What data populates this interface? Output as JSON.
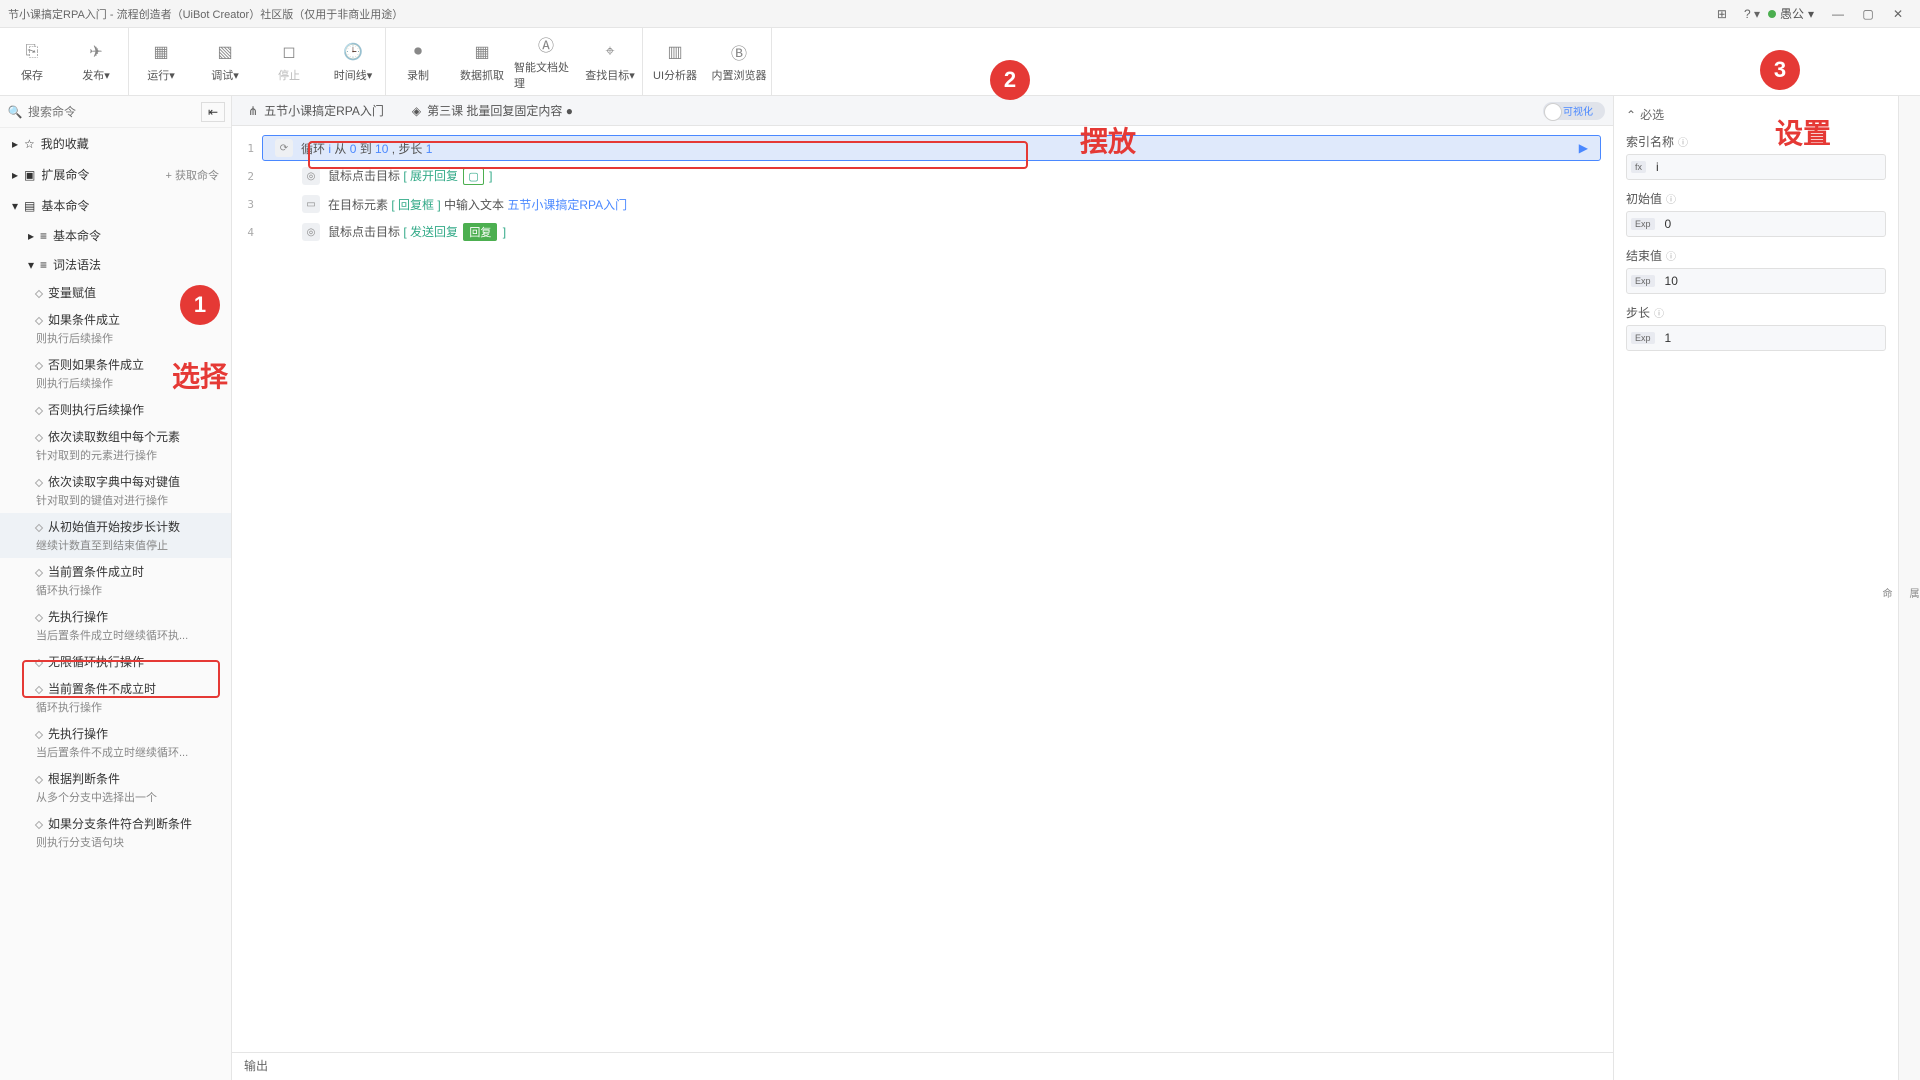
{
  "titlebar": {
    "title": "节小课搞定RPA入门 - 流程创造者（UiBot Creator）社区版（仅用于非商业用途）",
    "user": "愚公",
    "grid_icon": "⊞"
  },
  "toolbar": {
    "groups": [
      [
        {
          "label": "保存",
          "icon": "💾"
        },
        {
          "label": "发布▾",
          "icon": "✈"
        }
      ],
      [
        {
          "label": "运行▾",
          "icon": "▷"
        },
        {
          "label": "调试▾",
          "icon": "🐞"
        },
        {
          "label": "停止",
          "icon": "◻",
          "disabled": true
        },
        {
          "label": "时间线▾",
          "icon": "🕒"
        }
      ],
      [
        {
          "label": "录制",
          "icon": "⏺"
        },
        {
          "label": "数据抓取",
          "icon": "▦"
        },
        {
          "label": "智能文档处理",
          "icon": "Ⓐ"
        },
        {
          "label": "查找目标▾",
          "icon": "🔍"
        }
      ],
      [
        {
          "label": "UI分析器",
          "icon": "▥"
        },
        {
          "label": "内置浏览器",
          "icon": "Ⓑ"
        }
      ]
    ]
  },
  "sidebar": {
    "search_placeholder": "搜索命令",
    "acquire": "获取命令",
    "cats": [
      {
        "icon": "☆",
        "label": "我的收藏"
      },
      {
        "icon": "▣",
        "label": "扩展命令",
        "extra": true
      },
      {
        "icon": "▤",
        "label": "基本命令"
      }
    ],
    "subcats": [
      {
        "label": "基本命令",
        "expand": true
      },
      {
        "label": "词法语法",
        "expand": true
      }
    ],
    "cmds": [
      {
        "title": "变量赋值",
        "desc": ""
      },
      {
        "title": "如果条件成立",
        "desc": "则执行后续操作"
      },
      {
        "title": "否则如果条件成立",
        "desc": "则执行后续操作"
      },
      {
        "title": "否则执行后续操作",
        "desc": ""
      },
      {
        "title": "依次读取数组中每个元素",
        "desc": "针对取到的元素进行操作"
      },
      {
        "title": "依次读取字典中每对键值",
        "desc": "针对取到的键值对进行操作"
      },
      {
        "title": "从初始值开始按步长计数",
        "desc": "继续计数直至到结束值停止",
        "hl": true
      },
      {
        "title": "当前置条件成立时",
        "desc": "循环执行操作"
      },
      {
        "title": "先执行操作",
        "desc": "当后置条件成立时继续循环执..."
      },
      {
        "title": "无限循环执行操作",
        "desc": ""
      },
      {
        "title": "当前置条件不成立时",
        "desc": "循环执行操作"
      },
      {
        "title": "先执行操作",
        "desc": "当后置条件不成立时继续循环..."
      },
      {
        "title": "根据判断条件",
        "desc": "从多个分支中选择出一个"
      },
      {
        "title": "如果分支条件符合判断条件",
        "desc": "则执行分支语句块"
      }
    ]
  },
  "tabs": {
    "t1": {
      "icon": "⋔",
      "label": "五节小课搞定RPA入门"
    },
    "t2": {
      "icon": "◈",
      "label": "第三课 批量回复固定内容 ●"
    },
    "vis": "可视化"
  },
  "editor": {
    "lines": [
      {
        "n": "1",
        "icon": "⟳",
        "text_pre": "循环 ",
        "var": "i",
        "mid1": " 从 ",
        "v1": "0",
        "mid2": " 到 ",
        "v2": "10",
        "mid3": " , 步长 ",
        "v3": "1",
        "sel": true,
        "play": "▶"
      },
      {
        "n": "2",
        "icon": "◎",
        "text_pre": "鼠标点击目标 ",
        "tag": "[ 展开回复",
        "chip": "▢",
        "tag_close": "]",
        "indent": true
      },
      {
        "n": "3",
        "icon": "▭",
        "text_pre": "在目标元素 ",
        "tag": "[ 回复框",
        "tag_close": "]",
        "mid": " 中输入文本 ",
        "blue": "五节小课搞定RPA入门",
        "indent": true
      },
      {
        "n": "4",
        "icon": "◎",
        "text_pre": "鼠标点击目标 ",
        "tag": "[ 发送回复",
        "chip_green": "回复",
        "tag_close": "]",
        "indent": true
      }
    ]
  },
  "output": {
    "label": "输出"
  },
  "props": {
    "section": "必选",
    "fields": [
      {
        "label": "索引名称",
        "badge": "fx",
        "value": "i"
      },
      {
        "label": "初始值",
        "badge": "Exp",
        "value": "0"
      },
      {
        "label": "结束值",
        "badge": "Exp",
        "value": "10"
      },
      {
        "label": "步长",
        "badge": "Exp",
        "value": "1"
      }
    ]
  },
  "annotations": {
    "n1": "1",
    "t1": "选择",
    "n2": "2",
    "t2": "摆放",
    "n3": "3",
    "t3": "设置"
  }
}
